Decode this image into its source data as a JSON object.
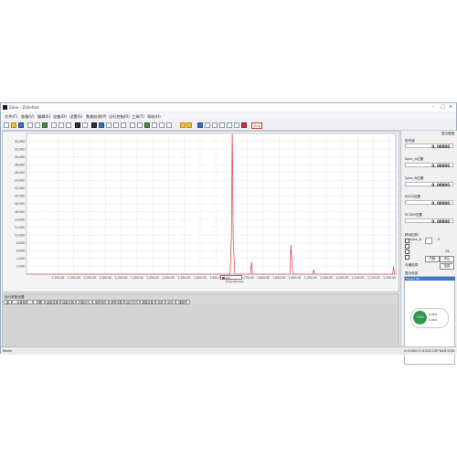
{
  "window": {
    "title": "Zolix - Zolixfast"
  },
  "menu": [
    "文件(F)",
    "查看(V)",
    "编辑(E)",
    "设备(D)",
    "设置(S)",
    "数据处理(P)",
    "运行控制(R)",
    "工具(T)",
    "帮助(H)"
  ],
  "toolbar": {
    "stop_label": "Stop"
  },
  "chart_data": {
    "type": "line",
    "xlim": [
      1050,
      2220
    ],
    "ylim": [
      0,
      36000
    ],
    "x_ticks": [
      "1,150.00",
      "1,200.00",
      "1,250.00",
      "1,300.00",
      "1,350.00",
      "1,400.00",
      "1,450.00",
      "1,500.00",
      "1,550.00",
      "1,600.00",
      "1,650.00",
      "1,700.00",
      "1,750.00",
      "1,800.00",
      "1,850.00",
      "1,900.00",
      "1,950.00",
      "2,000.00",
      "2,050.00",
      "2,100.00",
      "2,150.00",
      "2,200.00"
    ],
    "y_ticks": [
      "2,000",
      "4,000",
      "6,000",
      "8,000",
      "10,000",
      "12,000",
      "14,000",
      "16,000",
      "18,000",
      "20,000",
      "22,000",
      "24,000",
      "26,000",
      "28,000",
      "30,000",
      "32,000",
      "34,000"
    ],
    "grid": true,
    "legend": {
      "position": "bottom-center",
      "entries": [
        "D3-Import(line1)"
      ]
    },
    "series": [
      {
        "name": "D3-Import(line1)",
        "color": "#d82020",
        "x": [
          1050,
          1695,
          1699,
          1702,
          1705,
          1710,
          1760,
          1763,
          1766,
          1769,
          1885,
          1888,
          1891,
          1894,
          1957,
          1960,
          1963,
          2210,
          2213,
          2216,
          2220
        ],
        "y": [
          0,
          0,
          9000,
          36000,
          9000,
          0,
          0,
          3200,
          0,
          0,
          0,
          7500,
          2500,
          0,
          0,
          1200,
          0,
          0,
          2000,
          0,
          0
        ]
      }
    ]
  },
  "right_panel": {
    "header": "显示面板",
    "fields": [
      {
        "label": "信号道",
        "value": "0. 00000"
      },
      {
        "label": "Spec_A位置",
        "value": "0. 00000"
      },
      {
        "label": "Spec_B位置",
        "value": "0. 00000"
      },
      {
        "label": "SSCD位置",
        "value": "0. 00000"
      },
      {
        "label": "SC300位置",
        "value": "0. 00000"
      }
    ],
    "motion_title": "移动控制",
    "motion_item": "Spec_A",
    "motion_value": "0",
    "btn_ok": "Ok",
    "btn_run": "行程",
    "btn_stop": "停止",
    "range_label": "光栅选择",
    "apply": "应用",
    "hint_title": "提示信息",
    "hint_item": "Import OK"
  },
  "sub_panel": {
    "title": "运行参数设置",
    "tabs": [
      "图",
      "光谱采样",
      "光栅",
      "起始位置",
      "结束位置",
      "扫描步长",
      "采样延时",
      "采样次数",
      "运行方式",
      "减噪位置",
      "本底",
      "滤光",
      "通道号"
    ]
  },
  "status_bar": {
    "left": "Ready",
    "coords": "X=0,000,Y=0,000",
    "right": "CAP NUM SCRL"
  },
  "gauge": {
    "percent": "15%",
    "line1": "0.0K/s",
    "line2": "0.0K/s"
  }
}
